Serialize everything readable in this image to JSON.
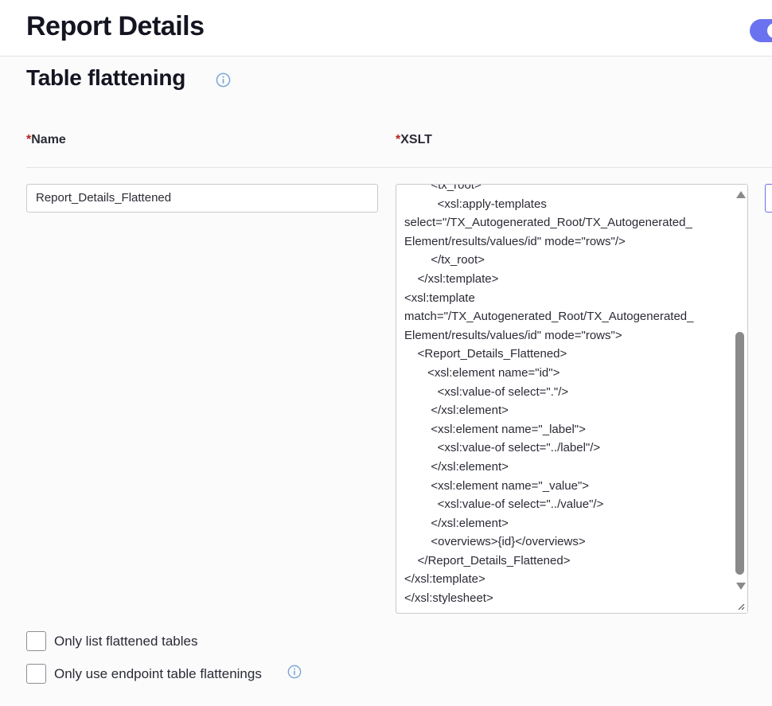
{
  "header": {
    "title": "Report Details",
    "toggle_on": true,
    "accent_color": "#6b72f0"
  },
  "section": {
    "title": "Table flattening",
    "info_icon": "info-circle-icon"
  },
  "columns": {
    "required_marker": "*",
    "name_label": "Name",
    "xslt_label": "XSLT"
  },
  "name_field": {
    "value": "Report_Details_Flattened"
  },
  "xslt_field": {
    "lines": [
      "        <tx_root>",
      "          <xsl:apply-templates",
      "select=\"/TX_Autogenerated_Root/TX_Autogenerated_",
      "Element/results/values/id\" mode=\"rows\"/>",
      "        </tx_root>",
      "    </xsl:template>",
      "<xsl:template",
      "match=\"/TX_Autogenerated_Root/TX_Autogenerated_",
      "Element/results/values/id\" mode=\"rows\">",
      "    <Report_Details_Flattened>",
      "       <xsl:element name=\"id\">",
      "          <xsl:value-of select=\".\"/>",
      "        </xsl:element>",
      "        <xsl:element name=\"_label\">",
      "          <xsl:value-of select=\"../label\"/>",
      "        </xsl:element>",
      "        <xsl:element name=\"_value\">",
      "          <xsl:value-of select=\"../value\"/>",
      "        </xsl:element>",
      "        <overviews>{id}</overviews>",
      "    </Report_Details_Flattened>",
      "</xsl:template>",
      "</xsl:stylesheet>"
    ],
    "scroll_position": 0.75
  },
  "options": [
    {
      "label": "Only list flattened tables",
      "checked": false,
      "has_info": false
    },
    {
      "label": "Only use endpoint table flattenings",
      "checked": false,
      "has_info": true,
      "info_icon": "info-circle-icon"
    }
  ]
}
